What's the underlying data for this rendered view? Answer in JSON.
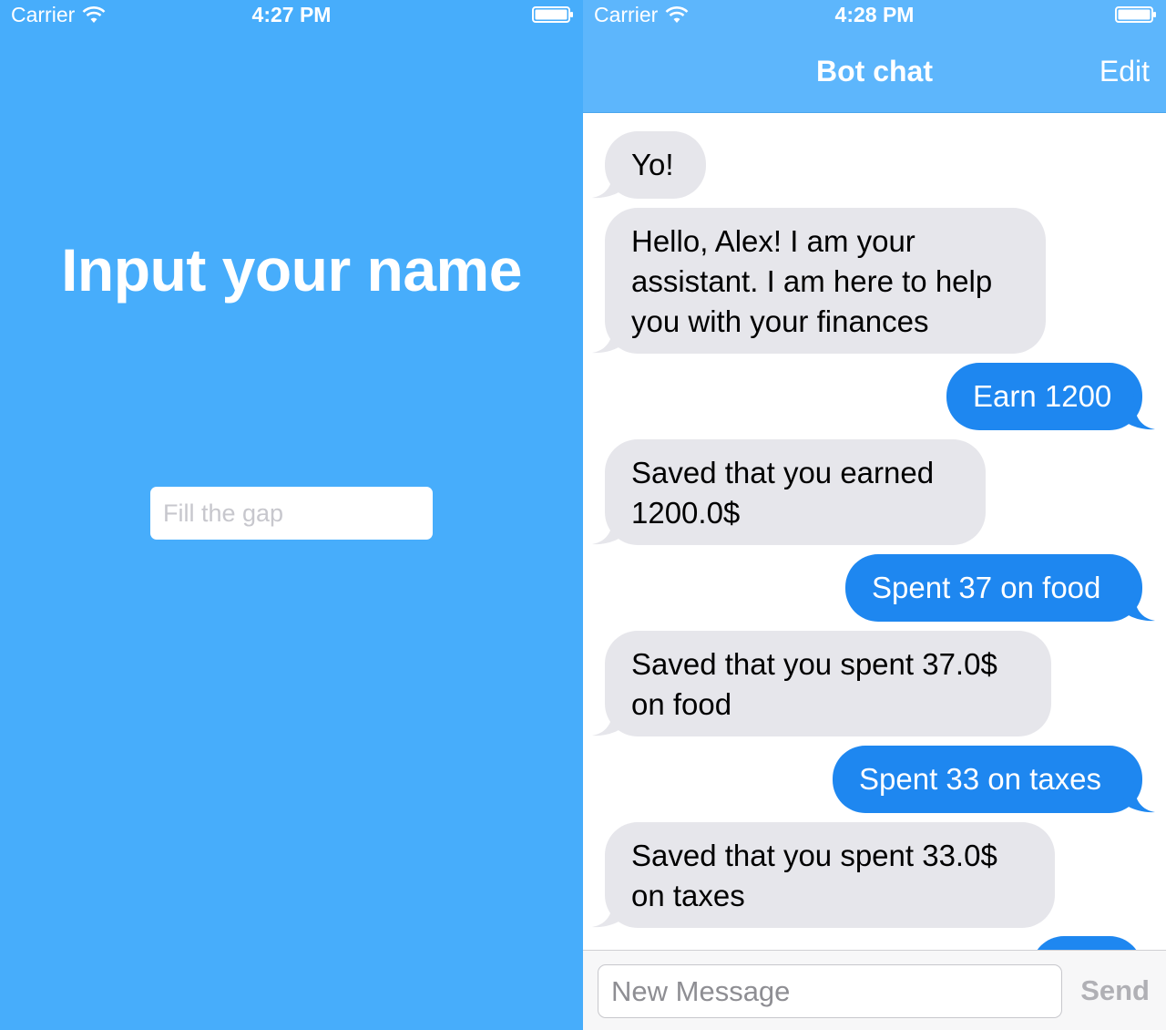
{
  "left_screen": {
    "status": {
      "carrier": "Carrier",
      "time": "4:27 PM"
    },
    "title": "Input your name",
    "name_input": {
      "placeholder": "Fill the gap",
      "value": ""
    }
  },
  "right_screen": {
    "status": {
      "carrier": "Carrier",
      "time": "4:28 PM"
    },
    "nav": {
      "title": "Bot chat",
      "edit_label": "Edit"
    },
    "messages": [
      {
        "sender": "bot",
        "text": "Yo!"
      },
      {
        "sender": "bot",
        "text": "Hello, Alex! I am your assistant. I am here to help you with your finances"
      },
      {
        "sender": "user",
        "text": "Earn 1200"
      },
      {
        "sender": "bot",
        "text": "Saved that you earned 1200.0$"
      },
      {
        "sender": "user",
        "text": "Spent 37 on food"
      },
      {
        "sender": "bot",
        "text": "Saved that you spent 37.0$ on food"
      },
      {
        "sender": "user",
        "text": "Spent 33 on taxes"
      },
      {
        "sender": "bot",
        "text": "Saved that you spent 33.0$ on taxes"
      }
    ],
    "input": {
      "placeholder": "New Message",
      "value": "",
      "send_label": "Send"
    }
  },
  "colors": {
    "left_background": "#47adfb",
    "navbar": "#5db6fc",
    "outgoing_bubble": "#1e87f0",
    "incoming_bubble": "#e6e6eb"
  }
}
